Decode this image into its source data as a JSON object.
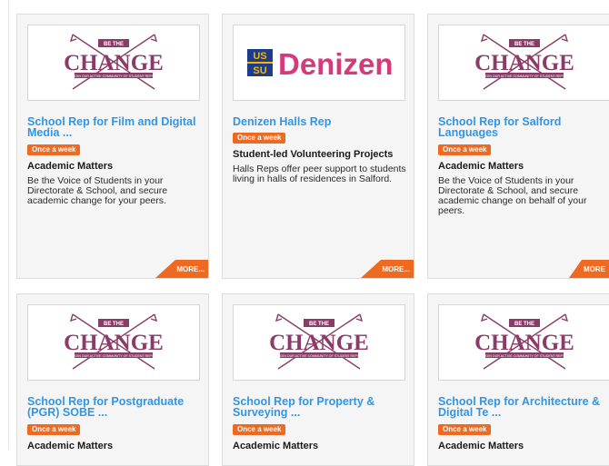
{
  "brand": {
    "accent": "#ef6a21",
    "link": "#2f96e8",
    "logo_purple": "#8a3c68"
  },
  "change_logo": {
    "top": "BE THE",
    "word": "CHANGE",
    "tagline": "JOIN OUR ACTIVE COMMUNITY OF STUDENT REPS"
  },
  "denizen_logo": {
    "mark_top": "US",
    "mark_bottom": "SU",
    "word": "Denizen"
  },
  "cards": [
    {
      "logo": "change",
      "title": "School Rep for Film and Digital Media ...",
      "badge": "Once a week",
      "category": "Academic Matters",
      "description": "Be the Voice of Students in your Directorate & School, and secure academic change for your peers.",
      "more": "MORE..."
    },
    {
      "logo": "denizen",
      "title": "Denizen Halls Rep",
      "badge": "Once a week",
      "category": "Student-led Volunteering Projects",
      "description": "Halls Reps offer peer support to students living in halls of residences in Salford.",
      "more": "MORE..."
    },
    {
      "logo": "change",
      "title": "School Rep for Salford Languages",
      "badge": "Once a week",
      "category": "Academic Matters",
      "description": "Be the Voice of Students in your Directorate & School, and secure academic change on behalf of your peers.",
      "more": "MORE"
    },
    {
      "logo": "change",
      "title": "School Rep for Postgraduate (PGR) SOBE ...",
      "badge": "Once a week",
      "category": "Academic Matters",
      "description": "",
      "more": ""
    },
    {
      "logo": "change",
      "title": "School Rep for Property & Surveying ...",
      "badge": "Once a week",
      "category": "Academic Matters",
      "description": "",
      "more": ""
    },
    {
      "logo": "change",
      "title": "School Rep for Architecture & Digital Te ...",
      "badge": "Once a week",
      "category": "Academic Matters",
      "description": "",
      "more": ""
    }
  ]
}
